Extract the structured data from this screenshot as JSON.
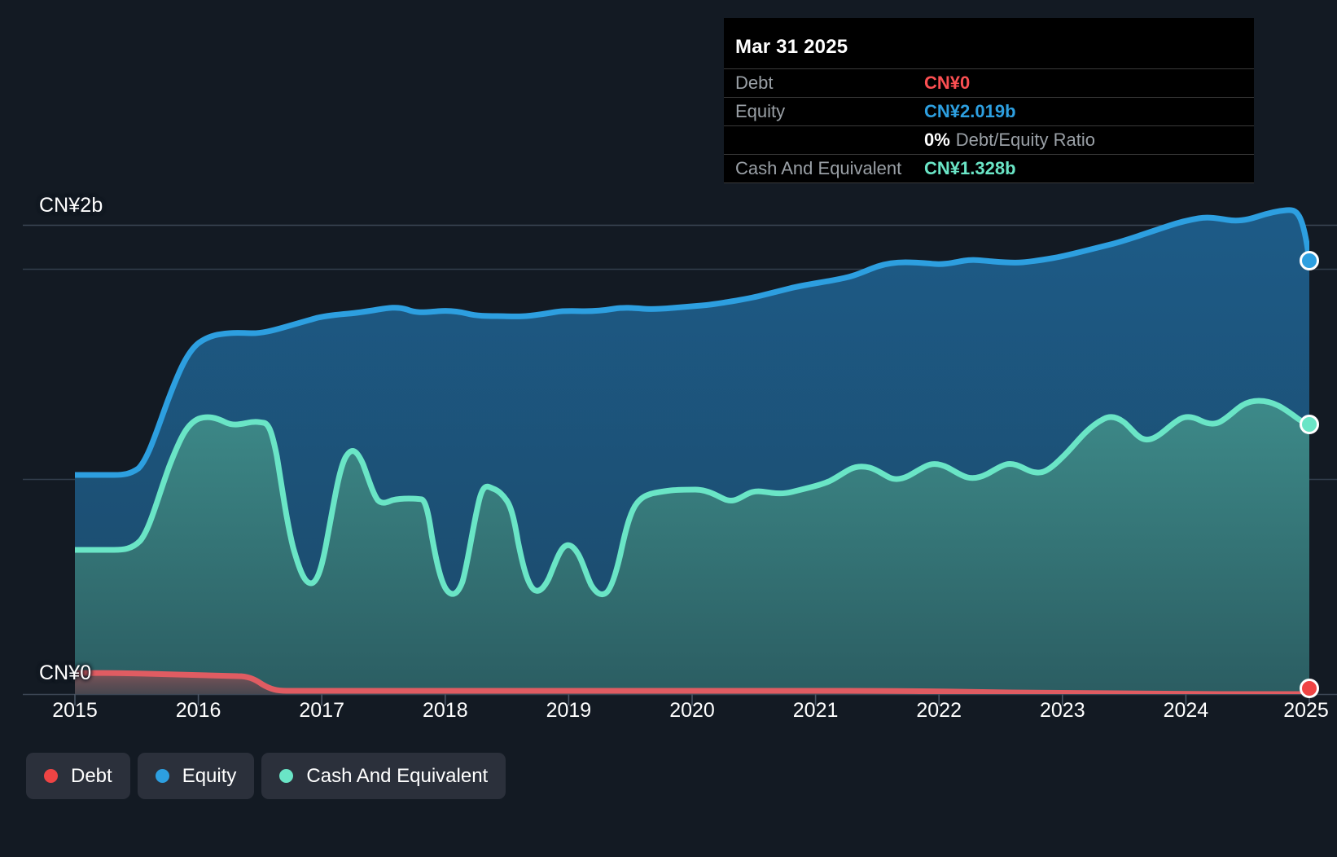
{
  "tooltip": {
    "title": "Mar 31 2025",
    "rows": [
      {
        "label": "Debt",
        "value": "CN¥0",
        "kind": "debt"
      },
      {
        "label": "Equity",
        "value": "CN¥2.019b",
        "kind": "equity"
      },
      {
        "label": "Cash And Equivalent",
        "value": "CN¥1.328b",
        "kind": "cash"
      }
    ],
    "ratio_value": "0%",
    "ratio_label": "Debt/Equity Ratio"
  },
  "legend": {
    "items": [
      {
        "label": "Debt",
        "color": "#ef4444"
      },
      {
        "label": "Equity",
        "color": "#2d9fe0"
      },
      {
        "label": "Cash And Equivalent",
        "color": "#6ae5c6"
      }
    ]
  },
  "axis": {
    "y_labels": {
      "top": "CN¥2b",
      "bottom": "CN¥0"
    },
    "x_labels": [
      "2015",
      "2016",
      "2017",
      "2018",
      "2019",
      "2020",
      "2021",
      "2022",
      "2023",
      "2024",
      "2025"
    ]
  },
  "colors": {
    "background": "#131a23",
    "debt": "#ef4444",
    "debt_line": "#e05c62",
    "equity": "#2d9fe0",
    "cash": "#6ae5c6",
    "grid": "#3c4654",
    "tooltip_bg": "#000000"
  },
  "chart_data": {
    "type": "area",
    "title": "Debt, Equity and Cash And Equivalent over time",
    "xlabel": "",
    "ylabel": "",
    "ylim": [
      0,
      2000
    ],
    "y_unit": "CN¥ millions",
    "grid": true,
    "legend_position": "bottom-left",
    "x_tick_labels": [
      "2015",
      "2016",
      "2017",
      "2018",
      "2019",
      "2020",
      "2021",
      "2022",
      "2023",
      "2024",
      "2025"
    ],
    "x_tick_values": [
      2015,
      2016,
      2017,
      2018,
      2019,
      2020,
      2021,
      2022,
      2023,
      2024,
      2025
    ],
    "x": [
      2015.0,
      2015.12,
      2015.25,
      2015.37,
      2015.5,
      2015.62,
      2015.75,
      2015.87,
      2016.0,
      2016.12,
      2016.25,
      2016.37,
      2016.5,
      2016.62,
      2016.75,
      2016.87,
      2017.0,
      2017.12,
      2017.25,
      2017.37,
      2017.5,
      2017.62,
      2017.75,
      2017.87,
      2018.0,
      2018.12,
      2018.25,
      2018.37,
      2018.5,
      2018.62,
      2018.75,
      2018.87,
      2019.0,
      2019.12,
      2019.25,
      2019.37,
      2019.5,
      2019.62,
      2019.75,
      2019.87,
      2020.0,
      2020.12,
      2020.25,
      2020.37,
      2020.5,
      2020.62,
      2020.75,
      2020.87,
      2021.0,
      2021.12,
      2021.25,
      2021.37,
      2021.5,
      2021.62,
      2021.75,
      2021.87,
      2022.0,
      2022.12,
      2022.25,
      2022.37,
      2022.5,
      2022.62,
      2022.75,
      2022.87,
      2023.0,
      2023.12,
      2023.25,
      2023.37,
      2023.5,
      2023.62,
      2023.75,
      2023.87,
      2024.0,
      2024.12,
      2024.25,
      2024.37,
      2024.5,
      2024.62,
      2024.75,
      2024.87,
      2025.0,
      2025.25
    ],
    "series": [
      {
        "name": "Equity",
        "color": "#2d9fe0",
        "values": [
          800,
          800,
          800,
          805,
          880,
          1010,
          1130,
          1210,
          1252,
          1262,
          1266,
          1268,
          1272,
          1286,
          1302,
          1318,
          1330,
          1338,
          1342,
          1346,
          1360,
          1372,
          1378,
          1372,
          1368,
          1374,
          1380,
          1375,
          1370,
          1368,
          1366,
          1370,
          1374,
          1380,
          1386,
          1390,
          1386,
          1382,
          1384,
          1390,
          1396,
          1400,
          1404,
          1410,
          1416,
          1424,
          1432,
          1442,
          1452,
          1462,
          1472,
          1480,
          1490,
          1500,
          1512,
          1530,
          1556,
          1570,
          1574,
          1572,
          1570,
          1578,
          1586,
          1580,
          1572,
          1576,
          1584,
          1592,
          1600,
          1612,
          1622,
          1634,
          1650,
          1668,
          1690,
          1712,
          1740,
          1766,
          1780,
          1778,
          1790,
          2019
        ]
      },
      {
        "name": "Cash And Equivalent",
        "color": "#6ae5c6",
        "values": [
          378,
          378,
          378,
          382,
          470,
          640,
          790,
          890,
          940,
          948,
          930,
          928,
          946,
          948,
          880,
          700,
          520,
          600,
          760,
          660,
          540,
          560,
          562,
          560,
          420,
          330,
          560,
          720,
          520,
          330,
          400,
          640,
          480,
          340,
          330,
          420,
          470,
          420,
          330,
          420,
          600,
          720,
          742,
          744,
          742,
          700,
          712,
          740,
          716,
          730,
          742,
          748,
          742,
          756,
          790,
          840,
          856,
          830,
          828,
          852,
          880,
          852,
          840,
          870,
          852,
          832,
          870,
          900,
          880,
          900,
          960,
          1030,
          1090,
          1040,
          1010,
          1070,
          1100,
          1080,
          1120,
          1190,
          1240,
          1328
        ]
      },
      {
        "name": "Debt",
        "color": "#ef4444",
        "values": [
          20,
          20,
          20,
          20,
          18,
          17,
          16,
          15,
          14,
          14,
          13,
          13,
          13,
          12,
          8,
          3,
          1,
          1,
          1,
          1,
          1,
          1,
          1,
          1,
          1,
          1,
          1,
          1,
          1,
          1,
          1,
          1,
          1,
          1,
          1,
          1,
          1,
          1,
          1,
          1,
          1,
          1,
          1,
          1,
          1,
          1,
          1,
          1,
          1,
          1,
          1,
          1,
          1,
          1,
          0,
          0,
          0,
          0,
          0,
          0,
          0,
          0,
          0,
          0,
          0,
          0,
          0,
          0,
          0,
          0,
          0,
          0,
          0,
          0,
          0,
          0,
          0,
          0,
          0,
          0,
          0,
          0
        ]
      }
    ],
    "annotations": {
      "highlight_date": "Mar 31 2025",
      "highlight_values": {
        "Debt": "CN¥0",
        "Equity": "CN¥2.019b",
        "Cash And Equivalent": "CN¥1.328b",
        "Debt/Equity Ratio": "0%"
      }
    }
  }
}
